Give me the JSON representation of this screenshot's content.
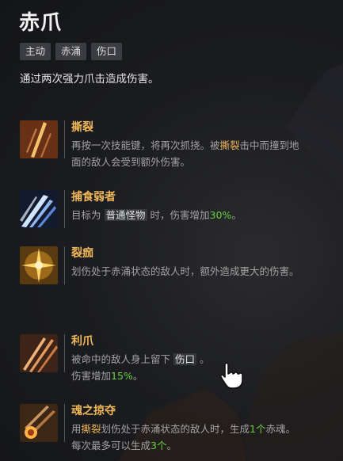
{
  "skill": {
    "name": "赤爪",
    "tags": [
      "主动",
      "赤涌",
      "伤口"
    ],
    "description": "通过两次强力爪击造成伤害。"
  },
  "nodes": [
    {
      "name": "撕裂",
      "icon": "claw-slash-icon",
      "line1_a": "再按一次技能键，将再次抓挠。被",
      "line1_hl": "撕裂",
      "line1_b": "击中而撞到地",
      "line2": "面的敌人会受到额外伤害。"
    },
    {
      "name": "捕食弱者",
      "icon": "blue-claw-icon",
      "text_a": "目标为",
      "text_kw": "普通怪物",
      "text_b": "时，伤害增加",
      "text_value": "30%",
      "text_end": "。"
    },
    {
      "name": "裂痂",
      "icon": "burst-icon",
      "text": "划伤处于赤涌状态的敌人时，额外造成更大的伤害。"
    },
    {
      "name": "利爪",
      "icon": "claw-marks-icon",
      "line1_a": "被命中的敌人身上留下",
      "line1_kw": "伤口",
      "line1_b": "。",
      "line2_a": "伤害增加",
      "line2_value": "15%",
      "line2_end": "。"
    },
    {
      "name": "魂之掠夺",
      "icon": "soul-orb-icon",
      "line1_a": "用",
      "line1_hl": "撕裂",
      "line1_b": "划伤处于赤涌状态的敌人时，生成",
      "line1_value": "1个",
      "line1_end": "赤魂。",
      "line2_a": "每次最多可以生成",
      "line2_value": "3个",
      "line2_end": "。"
    }
  ],
  "cursor": {
    "icon": "hand-pointer-icon"
  }
}
